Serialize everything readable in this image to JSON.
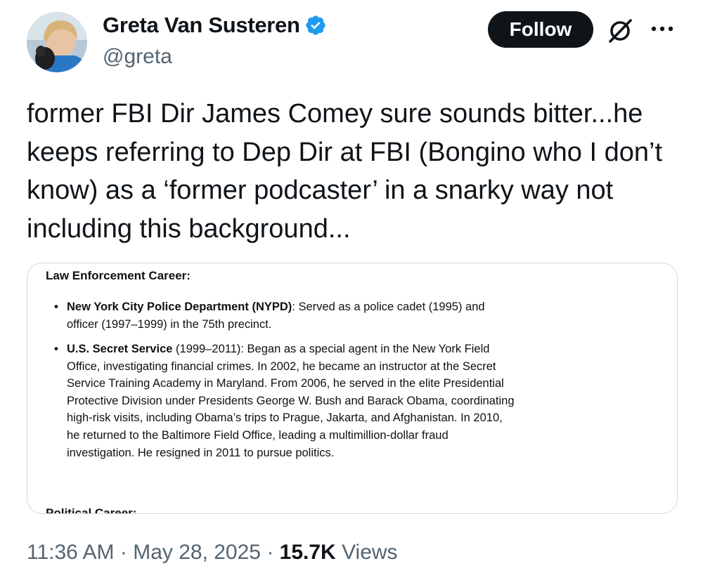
{
  "author": {
    "display_name": "Greta Van Susteren",
    "handle": "@greta",
    "verified_icon": "verified-badge-icon",
    "verified_color": "#1d9bf0"
  },
  "actions": {
    "follow_label": "Follow",
    "grok_icon": "grok-icon",
    "more_icon": "more-options-icon"
  },
  "tweet": {
    "lines": [
      "former FBI Dir James Comey sure sounds bitter...he",
      "keeps referring to Dep Dir at FBI (Bongino who I don’t",
      "know) as a ‘former podcaster’ in a snarky way not",
      "including this background..."
    ]
  },
  "media_image": {
    "heading": "Law Enforcement Career:",
    "bullets": [
      {
        "title": "New York City Police Department (NYPD)",
        "text": ": Served as a police cadet (1995) and officer (1997–1999) in the 75th precinct."
      },
      {
        "title": "U.S. Secret Service",
        "text": " (1999–2011): Began as a special agent in the New York Field Office, investigating financial crimes. In 2002, he became an instructor at the Secret Service Training Academy in Maryland. From 2006, he served in the elite Presidential Protective Division under Presidents George W. Bush and Barack Obama, coordinating high-risk visits, including Obama’s trips to Prague, Jakarta, and Afghanistan. In 2010, he returned to the Baltimore Field Office, leading a multimillion-dollar fraud investigation. He resigned in 2011 to pursue politics."
      }
    ],
    "cut_off_heading": "Political Career:"
  },
  "meta": {
    "time": "11:36 AM",
    "separator": " · ",
    "date": "May 28, 2025",
    "views_count": "15.7K",
    "views_label": " Views"
  }
}
